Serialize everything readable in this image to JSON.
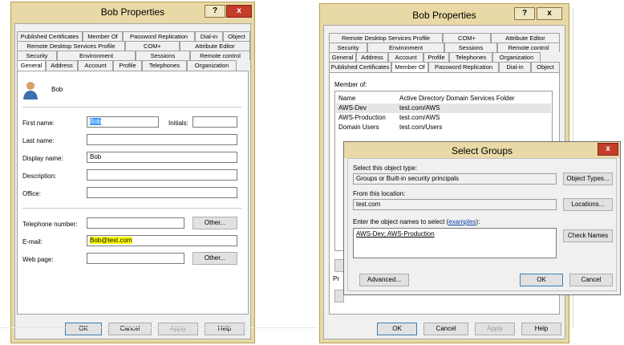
{
  "left": {
    "title": "Bob Properties",
    "help_btn": "?",
    "close_btn": "x",
    "tabs_row1": [
      "Published Certificates",
      "Member Of",
      "Password Replication",
      "Dial-in",
      "Object"
    ],
    "tabs_row2": [
      "Remote Desktop Services Profile",
      "COM+",
      "Attribute Editor"
    ],
    "tabs_row3": [
      "Security",
      "Environment",
      "Sessions",
      "Remote control"
    ],
    "tabs_row4": [
      "General",
      "Address",
      "Account",
      "Profile",
      "Telephones",
      "Organization"
    ],
    "user_name": "Bob",
    "fields": {
      "first_name_label": "First name:",
      "first_name_value": "Bob",
      "initials_label": "Initials:",
      "last_name_label": "Last name:",
      "display_name_label": "Display name:",
      "display_name_value": "Bob",
      "description_label": "Description:",
      "office_label": "Office:",
      "telephone_label": "Telephone number:",
      "email_label": "E-mail:",
      "email_value": "Bob@test.com",
      "webpage_label": "Web page:",
      "other_btn": "Other..."
    },
    "buttons": {
      "ok": "OK",
      "cancel": "Cancel",
      "apply": "Apply",
      "help": "Help"
    }
  },
  "right": {
    "title": "Bob Properties",
    "help_btn": "?",
    "close_btn": "x",
    "tabs_row1": [
      "Remote Desktop Services Profile",
      "COM+",
      "Attribute Editor"
    ],
    "tabs_row2": [
      "Security",
      "Environment",
      "Sessions",
      "Remote control"
    ],
    "tabs_row3": [
      "General",
      "Address",
      "Account",
      "Profile",
      "Telephones",
      "Organization"
    ],
    "tabs_row4": [
      "Published Certificates",
      "Member Of",
      "Password Replication",
      "Dial-in",
      "Object"
    ],
    "member_of_label": "Member of:",
    "columns": [
      "Name",
      "Active Directory Domain Services Folder"
    ],
    "rows": [
      {
        "name": "AWS-Dev",
        "folder": "test.com/AWS"
      },
      {
        "name": "AWS-Production",
        "folder": "test.com/AWS"
      },
      {
        "name": "Domain Users",
        "folder": "test.com/Users"
      }
    ],
    "pr_fragment": "Pr",
    "buttons": {
      "ok": "OK",
      "cancel": "Cancel",
      "apply": "Apply",
      "help": "Help"
    }
  },
  "select_groups": {
    "title": "Select Groups",
    "close_btn": "x",
    "object_type_label": "Select this object type:",
    "object_type_value": "Groups or Built-in security principals",
    "object_types_btn": "Object Types...",
    "location_label": "From this location:",
    "location_value": "test.com",
    "locations_btn": "Locations...",
    "names_label": "Enter the object names to select (",
    "examples_link": "examples",
    "names_label_end": "):",
    "names_value": "AWS-Dev; AWS-Production",
    "check_names_btn": "Check Names",
    "advanced_btn": "Advanced...",
    "ok_btn": "OK",
    "cancel_btn": "Cancel"
  }
}
